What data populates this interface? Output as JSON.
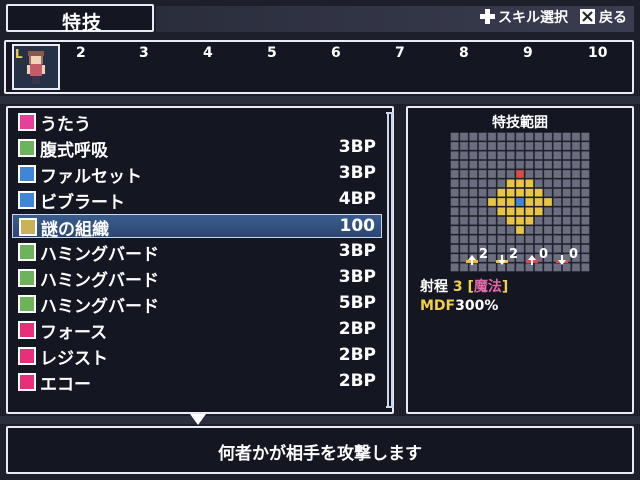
{
  "header": {
    "title": "特技",
    "skill_select_label": "スキル選択",
    "back_label": "戻る"
  },
  "party_bar": {
    "leader_badge": "L",
    "slots": [
      "2",
      "3",
      "4",
      "5",
      "6",
      "7",
      "8",
      "9",
      "10"
    ]
  },
  "skill_list": {
    "selected_index": 4,
    "items": [
      {
        "name": "うたう",
        "cost": "",
        "icon": "music-category-icon",
        "color": "#e83f9a"
      },
      {
        "name": "腹式呼吸",
        "cost": "3BP",
        "icon": "plus-icon",
        "color": "#6db35a"
      },
      {
        "name": "ファルセット",
        "cost": "3BP",
        "icon": "blue-square-icon",
        "color": "#3f86d6"
      },
      {
        "name": "ビブラート",
        "cost": "4BP",
        "icon": "blue-square-icon",
        "color": "#3f86d6"
      },
      {
        "name": "謎の組織",
        "cost": "100",
        "icon": "checker-icon",
        "color": "#c8b25a"
      },
      {
        "name": "ハミングバード",
        "cost": "3BP",
        "icon": "note-icon",
        "color": "#6db35a"
      },
      {
        "name": "ハミングバード",
        "cost": "3BP",
        "icon": "note-plus-icon",
        "color": "#6db35a"
      },
      {
        "name": "ハミングバード",
        "cost": "5BP",
        "icon": "note-plus2-icon",
        "color": "#6db35a"
      },
      {
        "name": "フォース",
        "cost": "2BP",
        "icon": "voice-icon",
        "color": "#e8307a"
      },
      {
        "name": "レジスト",
        "cost": "2BP",
        "icon": "voice-icon",
        "color": "#e8307a"
      },
      {
        "name": "エコー",
        "cost": "2BP",
        "icon": "voice-icon",
        "color": "#e8307a"
      }
    ]
  },
  "range_panel": {
    "title": "特技範囲",
    "stats": [
      {
        "value": "2",
        "color": "#f0b84a"
      },
      {
        "value": "2",
        "color": "#f0b84a"
      },
      {
        "value": "0",
        "color": "#d94a4a"
      },
      {
        "value": "0",
        "color": "#d94a4a"
      }
    ],
    "range_label": "射程",
    "range_value": "3",
    "range_type_open": "[",
    "range_type": "魔法",
    "range_type_close": "]",
    "mdf_label": "MDF",
    "mdf_value": "300%"
  },
  "description": "何者かが相手を攻撃します"
}
